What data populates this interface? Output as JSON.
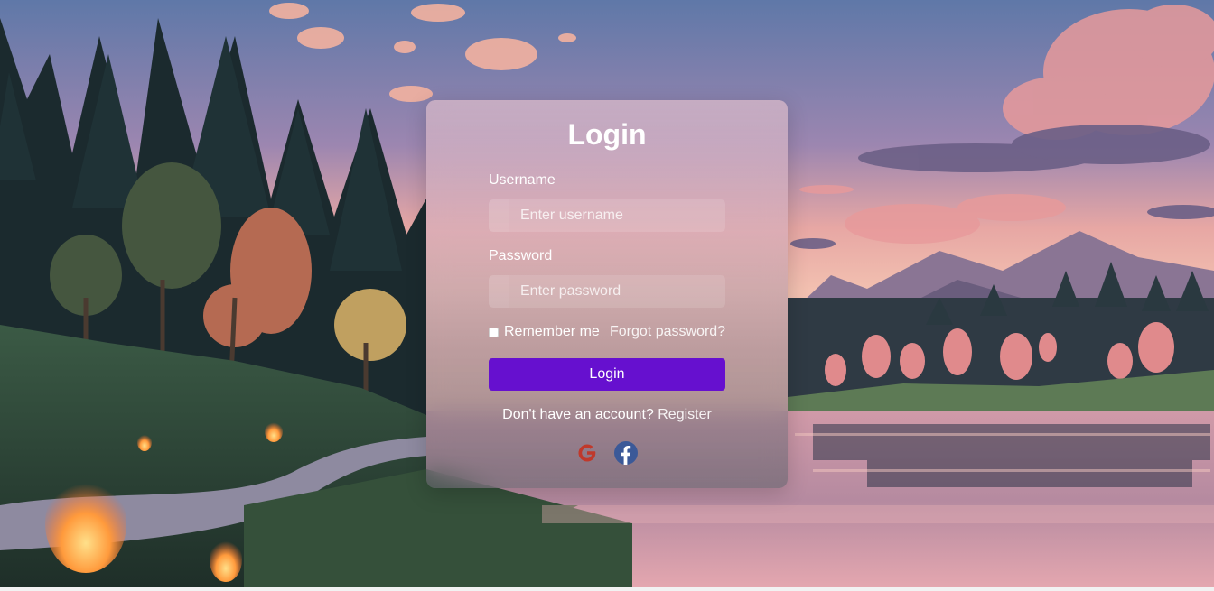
{
  "login_card": {
    "title": "Login",
    "username": {
      "label": "Username",
      "placeholder": "Enter username",
      "value": ""
    },
    "password": {
      "label": "Password",
      "placeholder": "Enter password",
      "value": ""
    },
    "remember_label": "Remember me",
    "remember_checked": false,
    "forgot_label": "Forgot password?",
    "submit_label": "Login",
    "register_prompt": "Don't have an account?",
    "register_label": "Register",
    "social_icons": [
      "google-icon",
      "facebook-icon"
    ]
  },
  "colors": {
    "primary_button": "#6610cf",
    "google": "#c0392b",
    "facebook": "#3b5998"
  }
}
